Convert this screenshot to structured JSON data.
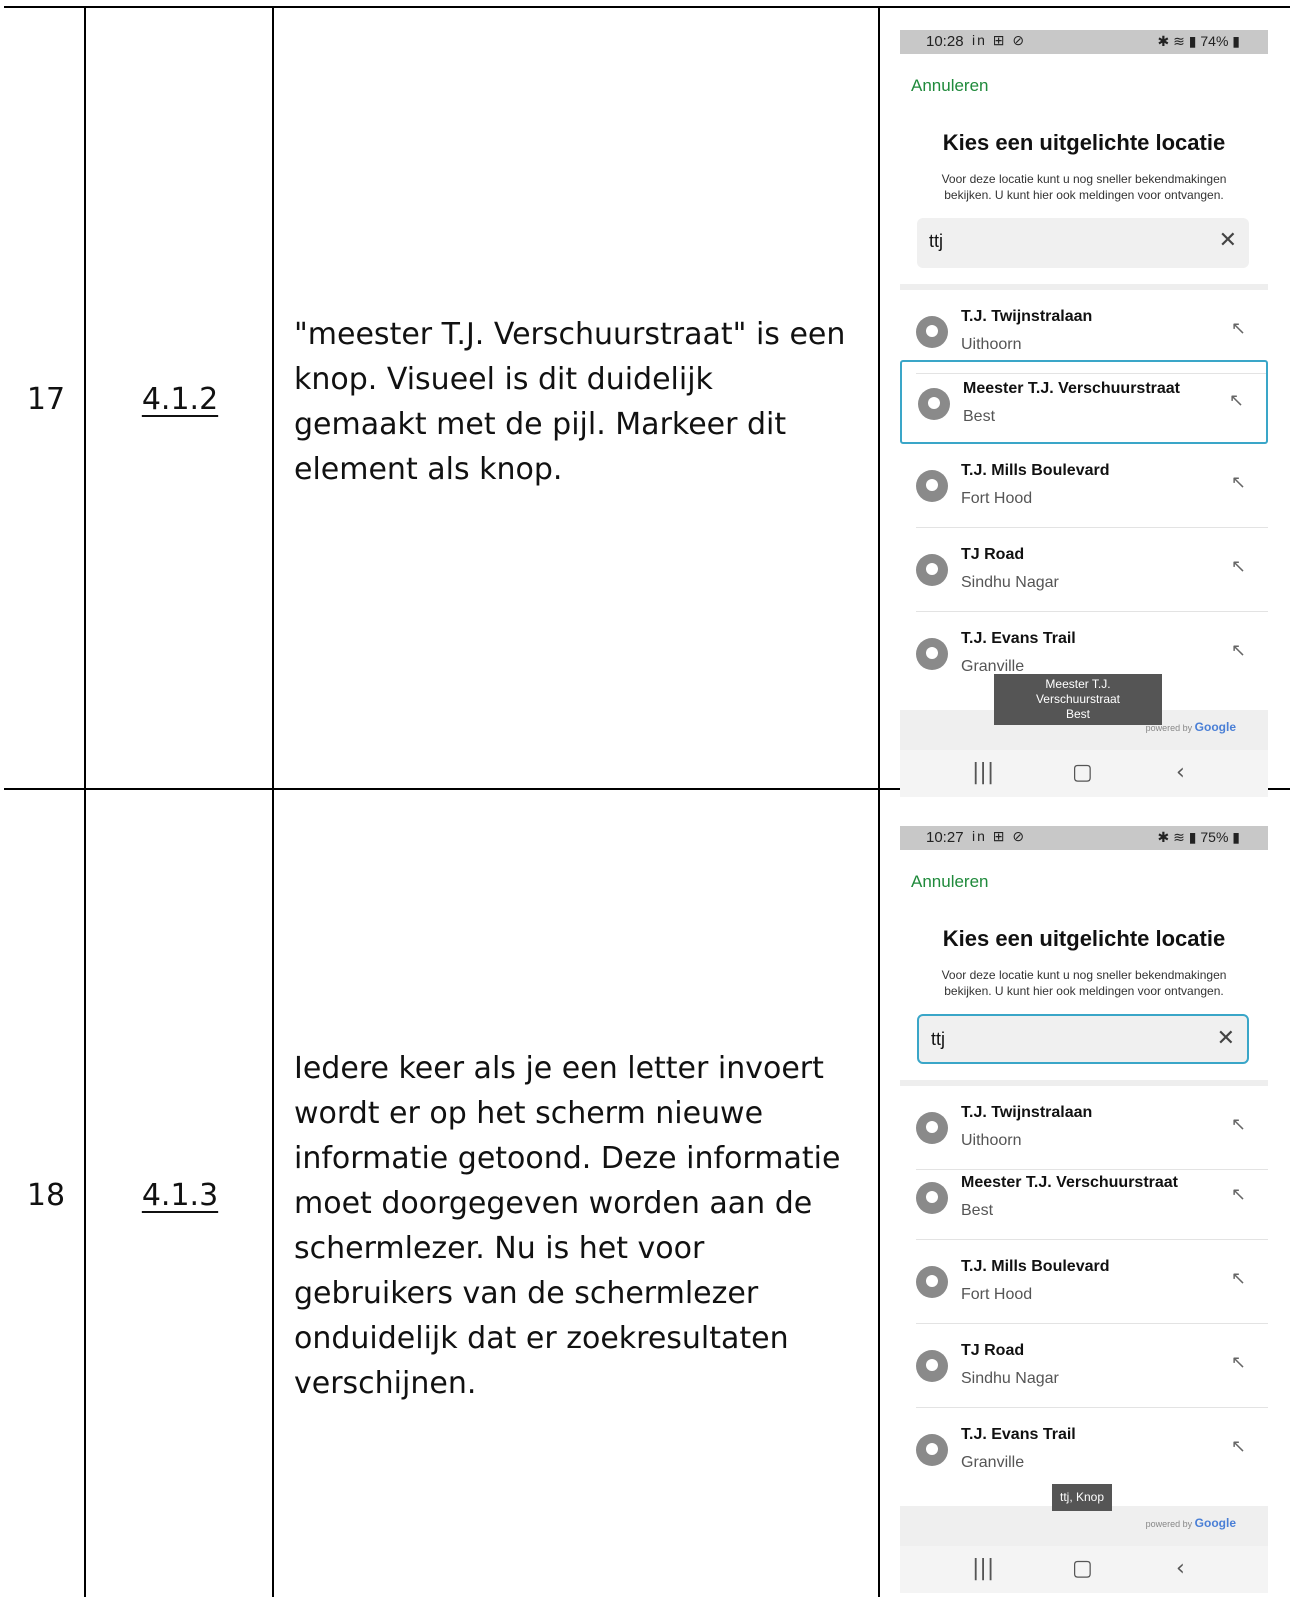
{
  "rows": [
    {
      "number": "17",
      "criterion": "4.1.2",
      "description": "\"meester T.J. Verschuurstraat\" is een knop. Visueel is dit duidelijk gemaakt met de pijl. Markeer dit element als knop.",
      "screenshot": {
        "time": "10:28",
        "status_icons": "in ⊞ ⊘",
        "battery": "74%",
        "tooltip_line1": "Meester T.J. Verschuurstraat",
        "tooltip_line2": "Best"
      }
    },
    {
      "number": "18",
      "criterion": "4.1.3",
      "description": "Iedere keer als je een letter invoert wordt er op het scherm nieuwe informatie getoond. Deze informatie moet doorgegeven worden aan de schermlezer. Nu is het voor gebruikers van de schermlezer onduidelijk dat er zoekresultaten verschijnen.",
      "screenshot": {
        "time": "10:27",
        "status_icons": "in ⊞ ⊘",
        "battery": "75%",
        "tooltip_line1": "ttj, Knop"
      }
    }
  ],
  "app": {
    "cancel_label": "Annuleren",
    "title": "Kies een uitgelichte locatie",
    "subtitle": "Voor deze locatie kunt u nog sneller bekendmakingen bekijken. U kunt hier ook meldingen voor ontvangen.",
    "search_value": "ttj",
    "powered_prefix": "powered by",
    "powered_brand": "Google",
    "results": [
      {
        "name": "T.J. Twijnstralaan",
        "place": "Uithoorn"
      },
      {
        "name": "Meester T.J. Verschuurstraat",
        "place": "Best"
      },
      {
        "name": "T.J. Mills Boulevard",
        "place": "Fort Hood"
      },
      {
        "name": "TJ Road",
        "place": "Sindhu Nagar"
      },
      {
        "name": "T.J. Evans Trail",
        "place": "Granville"
      }
    ]
  },
  "icons": {
    "clear": "close-icon",
    "result_pin": "location-pin-icon",
    "result_arrow": "arrow-up-left-icon",
    "nav_recent": "recent-apps-icon",
    "nav_home": "home-icon",
    "nav_back": "back-icon"
  },
  "colors": {
    "cancel": "#1f8a3b",
    "focus": "#3aa6c8"
  }
}
